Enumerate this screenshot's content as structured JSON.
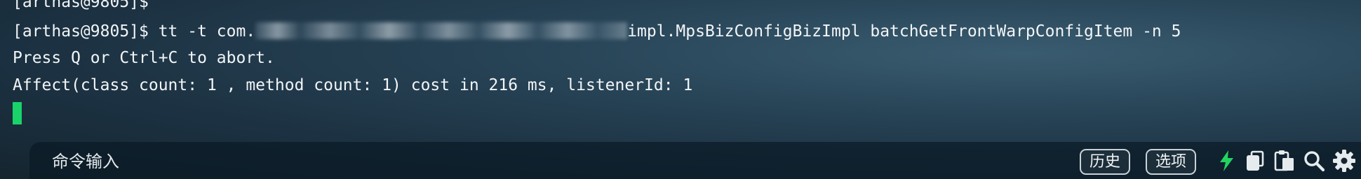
{
  "terminal": {
    "line0": "[arthas@9805]$",
    "line1_prefix": "[arthas@9805]$ tt -t com.",
    "line1_suffix": "impl.MpsBizConfigBizImpl batchGetFrontWarpConfigItem -n 5",
    "line2": "Press Q or Ctrl+C to abort.",
    "line3": "Affect(class count: 1 , method count: 1) cost in 216 ms, listenerId: 1"
  },
  "command_bar": {
    "input_placeholder": "命令输入",
    "history_label": "历史",
    "options_label": "选项"
  },
  "colors": {
    "cursor": "#19d36a",
    "bolt_icon": "#22d45f"
  },
  "icons": [
    "bolt-icon",
    "copy-icon",
    "paste-icon",
    "search-icon",
    "gear-icon"
  ]
}
